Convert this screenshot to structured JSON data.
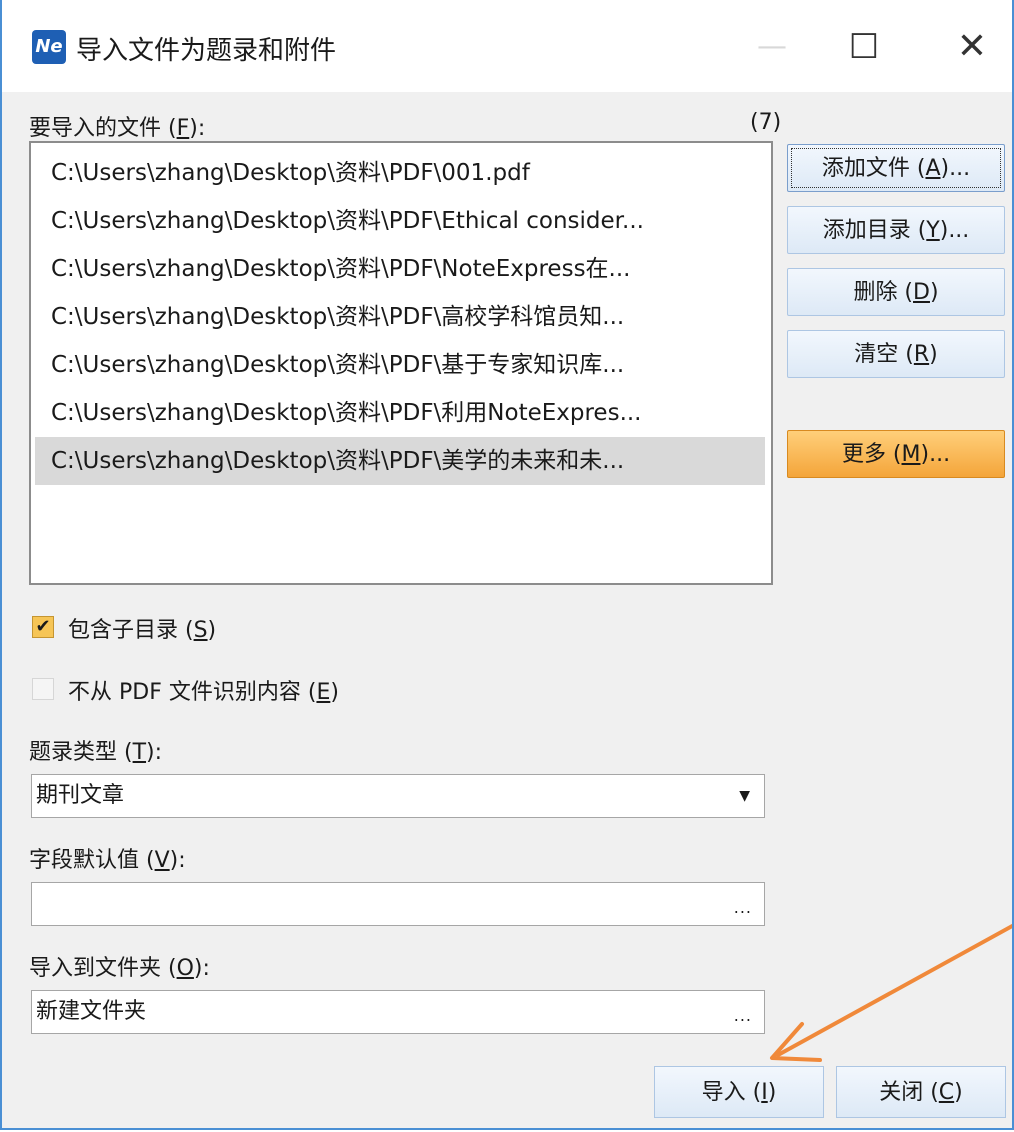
{
  "window": {
    "title": "导入文件为题录和附件",
    "app_icon_text": "Ne",
    "minimize_icon": "minimize-icon",
    "maximize_icon": "maximize-icon",
    "close_icon": "close-icon"
  },
  "files": {
    "label_text": "要导入的文件 (",
    "label_key": "F",
    "label_end": "):",
    "count": "(7)",
    "items": [
      "C:\\Users\\zhang\\Desktop\\资料\\PDF\\001.pdf",
      "C:\\Users\\zhang\\Desktop\\资料\\PDF\\Ethical consider...",
      "C:\\Users\\zhang\\Desktop\\资料\\PDF\\NoteExpress在...",
      "C:\\Users\\zhang\\Desktop\\资料\\PDF\\高校学科馆员知...",
      "C:\\Users\\zhang\\Desktop\\资料\\PDF\\基于专家知识库...",
      "C:\\Users\\zhang\\Desktop\\资料\\PDF\\利用NoteExpres...",
      "C:\\Users\\zhang\\Desktop\\资料\\PDF\\美学的未来和未..."
    ],
    "selected_index": 6
  },
  "buttons": {
    "add_file": {
      "text": "添加文件 (",
      "key": "A",
      "end": ")..."
    },
    "add_dir": {
      "text": "添加目录 (",
      "key": "Y",
      "end": ")..."
    },
    "delete": {
      "text": "删除 (",
      "key": "D",
      "end": ")"
    },
    "clear": {
      "text": "清空 (",
      "key": "R",
      "end": ")"
    },
    "more": {
      "text": "更多 (",
      "key": "M",
      "end": ")..."
    },
    "import": {
      "text": "导入 (",
      "key": "I",
      "end": ")"
    },
    "close": {
      "text": "关闭 (",
      "key": "C",
      "end": ")"
    }
  },
  "options": {
    "include_subdirs": {
      "text": "包含子目录 (",
      "key": "S",
      "end": ")",
      "checked": true
    },
    "no_pdf_recognition": {
      "text": "不从 PDF 文件识别内容 (",
      "key": "E",
      "end": ")",
      "checked": false
    }
  },
  "record_type": {
    "label_text": "题录类型 (",
    "label_key": "T",
    "label_end": "):",
    "value": "期刊文章"
  },
  "field_default": {
    "label_text": "字段默认值 (",
    "label_key": "V",
    "label_end": "):",
    "value": "",
    "button": "..."
  },
  "import_folder": {
    "label_text": "导入到文件夹 (",
    "label_key": "O",
    "label_end": "):",
    "value": "新建文件夹",
    "button": "..."
  },
  "annotation": {
    "arrow_color": "#f0893a"
  }
}
